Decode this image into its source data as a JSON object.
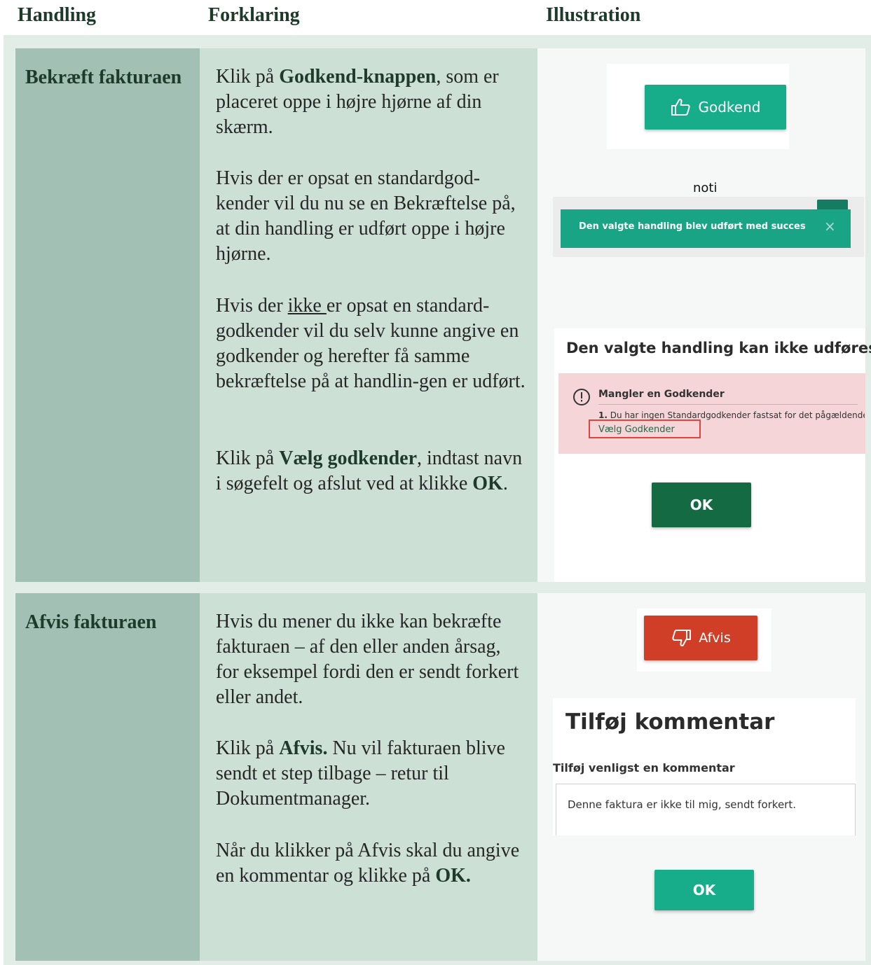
{
  "header": {
    "col1": "Handling",
    "col2": "Forklaring",
    "col3": "Illustration"
  },
  "rows": [
    {
      "action": "Bekræft fakturaen",
      "p1": {
        "a": "Klik på ",
        "b": "Godkend-knappen",
        "c": ", som er placeret oppe i højre hjørne af din skærm."
      },
      "p2": "Hvis der er opsat en standardgod-kender vil du nu se en Bekræftelse på, at din handling er udført oppe i højre hjørne.",
      "p3": {
        "a": "Hvis der ",
        "u": "ikke ",
        "c": "er opsat en standard-godkender vil du selv kunne angive en godkender og herefter få samme bekræftelse på at handlin-gen er udført."
      },
      "p4": {
        "a": "Klik på ",
        "b": "Vælg godkender",
        "c": ", indtast navn i søgefelt og afslut ved at klikke ",
        "d": "OK",
        "e": "."
      },
      "illustration": {
        "approve_button": "Godkend",
        "noti_label": "noti",
        "toast_text": "Den valgte handling blev udført med succes",
        "toast_close": "×",
        "error_title": "Den valgte handling kan ikke udføres",
        "error_heading": "Mangler en Godkender",
        "error_number": "1.",
        "error_detail": "Du har ingen Standardgodkender fastsat for det pågældende",
        "choose_link": "Vælg Godkender",
        "ok_button": "OK"
      }
    },
    {
      "action": "Afvis fakturaen",
      "p1": "Hvis du mener du ikke kan bekræfte fakturaen – af den eller anden årsag, for eksempel fordi den er sendt forkert eller andet.",
      "p2": {
        "a": "Klik på ",
        "b": "Afvis.",
        "c": " Nu vil fakturaen blive sendt et step tilbage – retur til Dokumentmanager."
      },
      "p3": {
        "a": "Når du klikker på Afvis skal du angive en kommentar og klikke på ",
        "b": "OK."
      },
      "illustration": {
        "reject_button": "Afvis",
        "comment_title": "Tilføj kommentar",
        "comment_label": "Tilføj venligst en kommentar",
        "comment_value": "Denne faktura er ikke til mig, sendt forkert.",
        "ok_button": "OK"
      }
    }
  ],
  "colors": {
    "green_button": "#17ad8b",
    "dark_green_button": "#136a43",
    "red_button": "#d13e27",
    "toast": "#1aa486",
    "error_bg": "#f6d5d8",
    "highlight_box": "#e0443e"
  }
}
